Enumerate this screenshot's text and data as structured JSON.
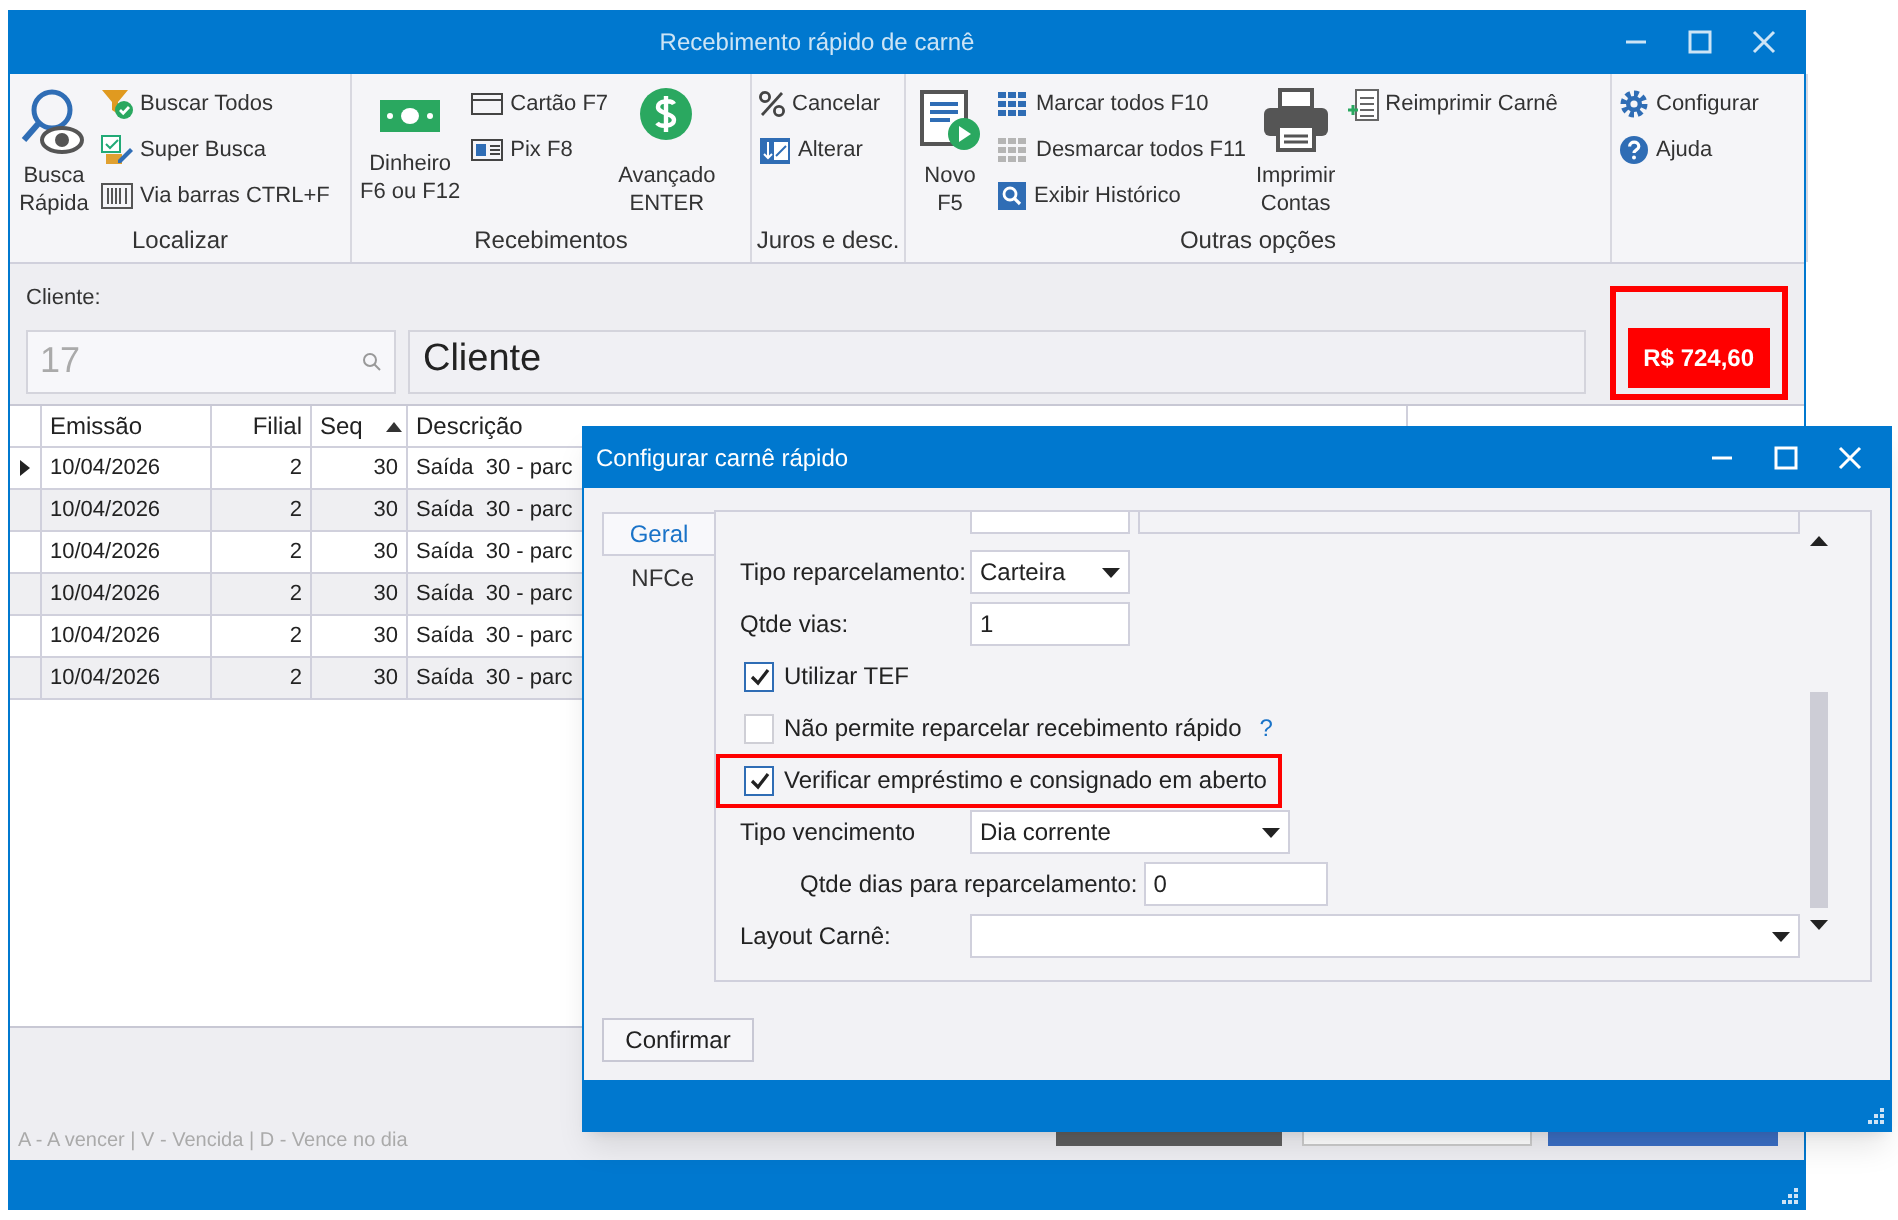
{
  "window": {
    "title": "Recebimento rápido de carnê"
  },
  "ribbon": {
    "groups": [
      {
        "label": "Localizar",
        "items": [
          {
            "kind": "large",
            "label": "Busca\nRápida"
          },
          {
            "kind": "small",
            "label": "Buscar Todos"
          },
          {
            "kind": "small",
            "label": "Super Busca"
          },
          {
            "kind": "small",
            "label": "Via barras CTRL+F"
          }
        ]
      },
      {
        "label": "Recebimentos",
        "items": [
          {
            "kind": "large",
            "label": "Dinheiro\nF6 ou F12"
          },
          {
            "kind": "small",
            "label": "Cartão F7"
          },
          {
            "kind": "small",
            "label": "Pix F8"
          },
          {
            "kind": "large",
            "label": "Avançado\nENTER"
          }
        ]
      },
      {
        "label": "Juros e desc.",
        "items": [
          {
            "kind": "small",
            "label": "Cancelar"
          },
          {
            "kind": "small",
            "label": "Alterar"
          }
        ]
      },
      {
        "label": "Outras opções",
        "items": [
          {
            "kind": "large",
            "label": "Novo\nF5"
          },
          {
            "kind": "small",
            "label": "Marcar todos F10"
          },
          {
            "kind": "small",
            "label": "Desmarcar todos F11"
          },
          {
            "kind": "small",
            "label": "Exibir Histórico"
          },
          {
            "kind": "large",
            "label": "Imprimir\nContas"
          },
          {
            "kind": "small",
            "label": "Reimprimir Carnê"
          }
        ]
      },
      {
        "items": [
          {
            "kind": "small",
            "label": "Configurar"
          },
          {
            "kind": "small",
            "label": "Ajuda"
          }
        ]
      }
    ]
  },
  "client": {
    "label": "Cliente:",
    "code": "17",
    "name": "Cliente",
    "total": "R$ 724,60",
    "highlighted": true
  },
  "table": {
    "columns": [
      {
        "label": "Emissão",
        "sorted": false
      },
      {
        "label": "Filial",
        "sorted": false
      },
      {
        "label": "Seq",
        "sorted": true
      },
      {
        "label": "Descrição",
        "sorted": false
      }
    ],
    "rows": [
      {
        "current": true,
        "cells": [
          "10/04/2026",
          "2",
          "30",
          "Saída  30 - parc"
        ]
      },
      {
        "current": false,
        "cells": [
          "10/04/2026",
          "2",
          "30",
          "Saída  30 - parc"
        ]
      },
      {
        "current": false,
        "cells": [
          "10/04/2026",
          "2",
          "30",
          "Saída  30 - parc"
        ]
      },
      {
        "current": false,
        "cells": [
          "10/04/2026",
          "2",
          "30",
          "Saída  30 - parc"
        ]
      },
      {
        "current": false,
        "cells": [
          "10/04/2026",
          "2",
          "30",
          "Saída  30 - parc"
        ]
      },
      {
        "current": false,
        "cells": [
          "10/04/2026",
          "2",
          "30",
          "Saída  30 - parc"
        ]
      }
    ]
  },
  "legend": "A - A vencer | V - Vencida | D - Vence no dia",
  "dialog": {
    "title": "Configurar carnê rápido",
    "tabs": [
      {
        "label": "Geral",
        "selected": true
      },
      {
        "label": "NFCe",
        "selected": false
      }
    ],
    "fields": [
      {
        "kind": "select",
        "label": "Tipo reparcelamento:",
        "value": "Carteira"
      },
      {
        "kind": "input",
        "label": "Qtde vias:",
        "value": "1"
      },
      {
        "kind": "checkbox",
        "label": "Utilizar TEF",
        "checked": true,
        "highlighted": false
      },
      {
        "kind": "checkbox",
        "label": "Não permite reparcelar recebimento rápido",
        "checked": false,
        "highlighted": false,
        "help": "?"
      },
      {
        "kind": "checkbox",
        "label": "Verificar empréstimo e consignado em aberto",
        "checked": true,
        "highlighted": true
      },
      {
        "kind": "select",
        "label": "Tipo vencimento",
        "value": "Dia corrente"
      },
      {
        "kind": "inline-input",
        "label": "Qtde dias para reparcelamento:",
        "value": "0"
      },
      {
        "kind": "wide-select",
        "label": "Layout Carnê:"
      }
    ],
    "confirm": "Confirmar"
  }
}
